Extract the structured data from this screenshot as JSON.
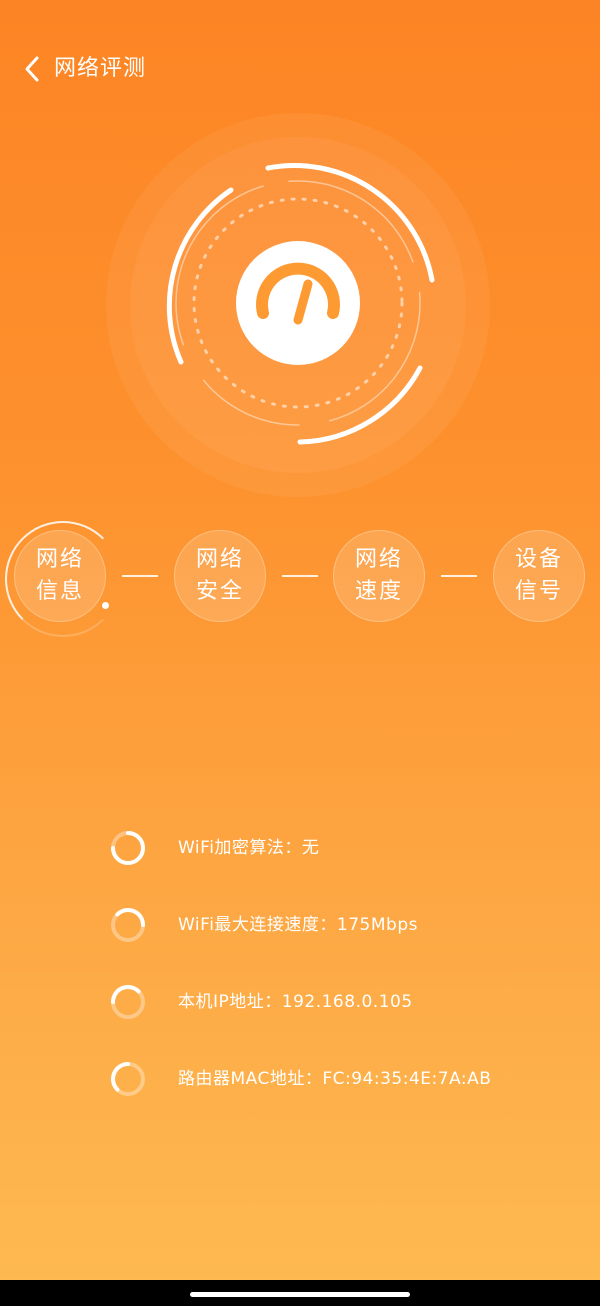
{
  "header": {
    "title": "网络评测",
    "back_icon": "chevron-left-icon"
  },
  "hero": {
    "icon": "speedometer-icon",
    "accent": "#fd9a32"
  },
  "steps": [
    {
      "label_line1": "网络",
      "label_line2": "信息",
      "active": true
    },
    {
      "label_line1": "网络",
      "label_line2": "安全",
      "active": false
    },
    {
      "label_line1": "网络",
      "label_line2": "速度",
      "active": false
    },
    {
      "label_line1": "设备",
      "label_line2": "信号",
      "active": false
    }
  ],
  "info": [
    {
      "text": "WiFi加密算法：无"
    },
    {
      "text": "WiFi最大连接速度：175Mbps"
    },
    {
      "text": "本机IP地址：192.168.0.105"
    },
    {
      "text": "路由器MAC地址：FC:94:35:4E:7A:AB"
    }
  ],
  "colors": {
    "bg_top": "#fd8424",
    "bg_bottom": "#feba51",
    "accent": "#fd9a32"
  }
}
